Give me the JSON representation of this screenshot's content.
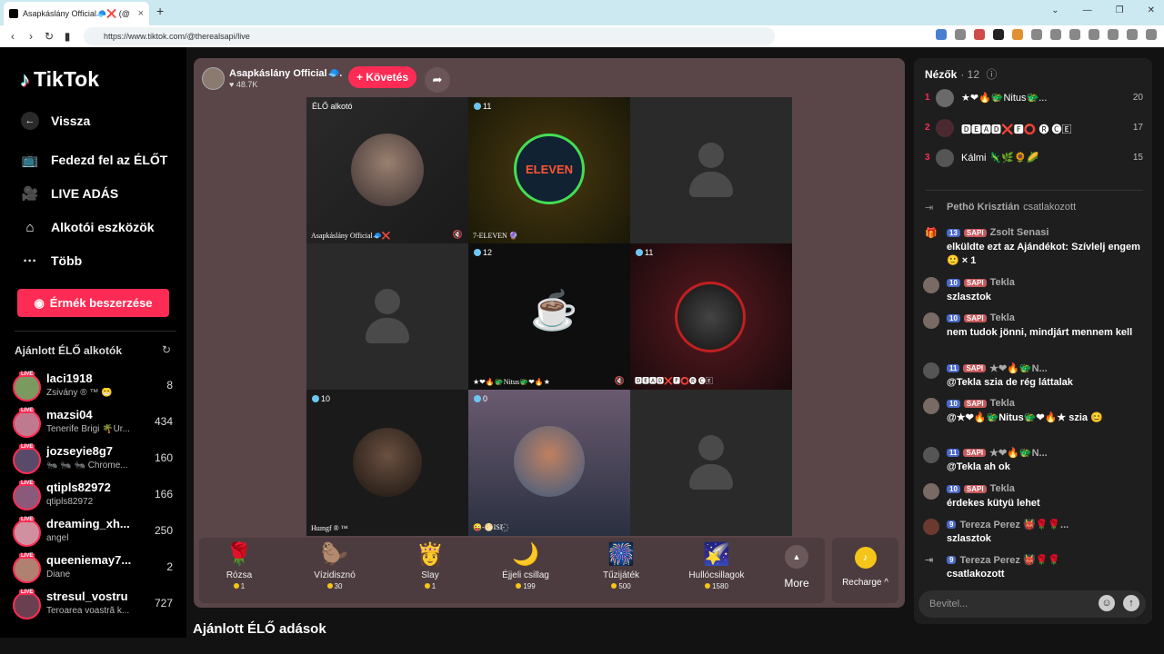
{
  "browser": {
    "tab_title": "Asapkáslány Official🧢❌ (@",
    "url": "https://www.tiktok.com/@therealsapi/live"
  },
  "sidebar": {
    "logo": "TikTok",
    "back": "Vissza",
    "nav": [
      "Fedezd fel az ÉLŐT",
      "LIVE ADÁS",
      "Alkotói eszközök",
      "Több"
    ],
    "coins_button": "Érmék beszerzése",
    "recommended_title": "Ajánlott ÉLŐ alkotók",
    "live_badge": "LIVE",
    "creators": [
      {
        "name": "laci1918",
        "sub": "Zsivány ® ™ 😁",
        "count": "8"
      },
      {
        "name": "mazsi04",
        "sub": "Tenerife Brigi 🌴Úr...",
        "count": "434"
      },
      {
        "name": "jozseyie8g7",
        "sub": "🐜 🐜 🐜 Chrome...",
        "count": "160"
      },
      {
        "name": "qtipls82972",
        "sub": "qtipls82972",
        "count": "166"
      },
      {
        "name": "dreaming_xh...",
        "sub": "angel",
        "count": "250"
      },
      {
        "name": "queeniemay7...",
        "sub": "Diane",
        "count": "2"
      },
      {
        "name": "stresul_vostru",
        "sub": "Teroarea voastră k...",
        "count": "727"
      }
    ]
  },
  "host": {
    "name": "Asapkáslány Official🧢...",
    "likes": "48.7K",
    "follow": "+ Követés"
  },
  "grid": [
    {
      "badge": "ÉLŐ alkotó",
      "label": "Asapkáslány Official🧢❌"
    },
    {
      "badge": "11",
      "label": "7-ELEVEN 🔮",
      "logo": "ELEVEN"
    },
    {
      "badge": "",
      "label": ""
    },
    {
      "badge": "",
      "label": ""
    },
    {
      "badge": "12",
      "label": "★❤🔥🐲Nitus🐲❤🔥★"
    },
    {
      "badge": "11",
      "label": "🅳🅴🅰🅳❌🅵⭕🅡 🅒🄴"
    },
    {
      "badge": "10",
      "label": "Hшngf ® ™"
    },
    {
      "badge": "0",
      "label": "😜-🌕ISI-꙰"
    },
    {
      "badge": "",
      "label": ""
    }
  ],
  "gifts": [
    {
      "name": "Rózsa",
      "price": "1",
      "icon": "🌹"
    },
    {
      "name": "Vízidisznó",
      "price": "30",
      "icon": "🦫"
    },
    {
      "name": "Slay",
      "price": "1",
      "icon": "👸"
    },
    {
      "name": "Éjjeli csillag",
      "price": "199",
      "icon": "🌙"
    },
    {
      "name": "Tűzijáték",
      "price": "500",
      "icon": "🎆"
    },
    {
      "name": "Hullócsillagok",
      "price": "1580",
      "icon": "🌠"
    }
  ],
  "more_label": "More",
  "recharge_label": "Recharge ^",
  "recommended_live": "Ajánlott ÉLŐ adások",
  "chat": {
    "viewers_title": "Nézők",
    "viewers_count": "· 12",
    "top_viewers": [
      {
        "rank": "1",
        "name": "★❤🔥🐲Nitus🐲...",
        "score": "20"
      },
      {
        "rank": "2",
        "name": "🅳🅴🅰🅳❌🅵⭕ 🅡 🅒🄴",
        "score": "17"
      },
      {
        "rank": "3",
        "name": "Kálmi 🦎🌿🌻🌽",
        "score": "15"
      }
    ],
    "messages": [
      {
        "user": "Pethö Krisztián",
        "text": "csatlakozott",
        "level": "",
        "fan": "",
        "system": true
      },
      {
        "user": "Zsolt Senasi",
        "text": "elküldte ezt az Ajándékot: Szívlelj engem 🙂 × 1",
        "level": "13",
        "fan": "SAPI"
      },
      {
        "user": "Tekla",
        "text": "szlasztok",
        "level": "10",
        "fan": "SAPI"
      },
      {
        "user": "Tekla",
        "text": "nem tudok jönni, mindjárt mennem kell",
        "level": "10",
        "fan": "SAPI"
      },
      {
        "user": "★❤🔥🐲N...",
        "text": "@Tekla szia de rég láttalak",
        "level": "11",
        "fan": "SAPI"
      },
      {
        "user": "Tekla",
        "text": "@★❤🔥🐲Nitus🐲❤🔥★ szia 😊",
        "level": "10",
        "fan": "SAPI"
      },
      {
        "user": "★❤🔥🐲N...",
        "text": "@Tekla ah ok",
        "level": "11",
        "fan": "SAPI"
      },
      {
        "user": "Tekla",
        "text": "érdekes kütyü lehet",
        "level": "10",
        "fan": "SAPI"
      },
      {
        "user": "Tereza Perez 👹🌹🌹...",
        "text": "szlasztok",
        "level": "9",
        "fan": ""
      },
      {
        "user": "Tereza Perez 👹🌹🌹",
        "text": "csatlakozott",
        "level": "9",
        "fan": ""
      }
    ],
    "input_placeholder": "Bevitel..."
  }
}
